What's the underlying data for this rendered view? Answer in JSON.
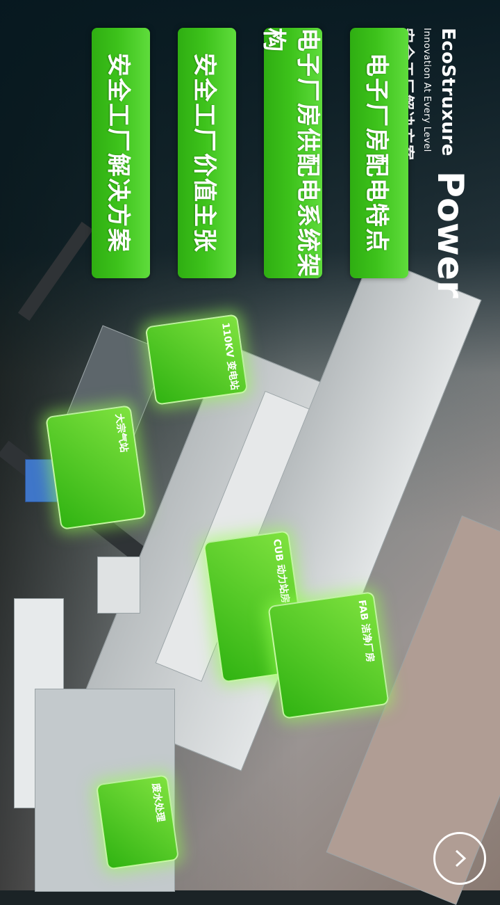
{
  "brand": {
    "logo": "EcoStruxure",
    "product": "Power",
    "tagline": "Innovation At Every Level",
    "subtitle": "安全工厂解决方案"
  },
  "menu": [
    {
      "label": "电子厂房配电特点"
    },
    {
      "label": "电子厂房供配电系统架构"
    },
    {
      "label": "安全工厂价值主张"
    },
    {
      "label": "安全工厂解决方案"
    }
  ],
  "hotspots": [
    {
      "label": "110KV 变电站"
    },
    {
      "label": "大宗气站"
    },
    {
      "label": "CUB 动力站房"
    },
    {
      "label": "FAB 洁净厂房"
    },
    {
      "label": "废水处理"
    }
  ],
  "icons": {
    "scroll_top": "chevron-up-icon"
  }
}
